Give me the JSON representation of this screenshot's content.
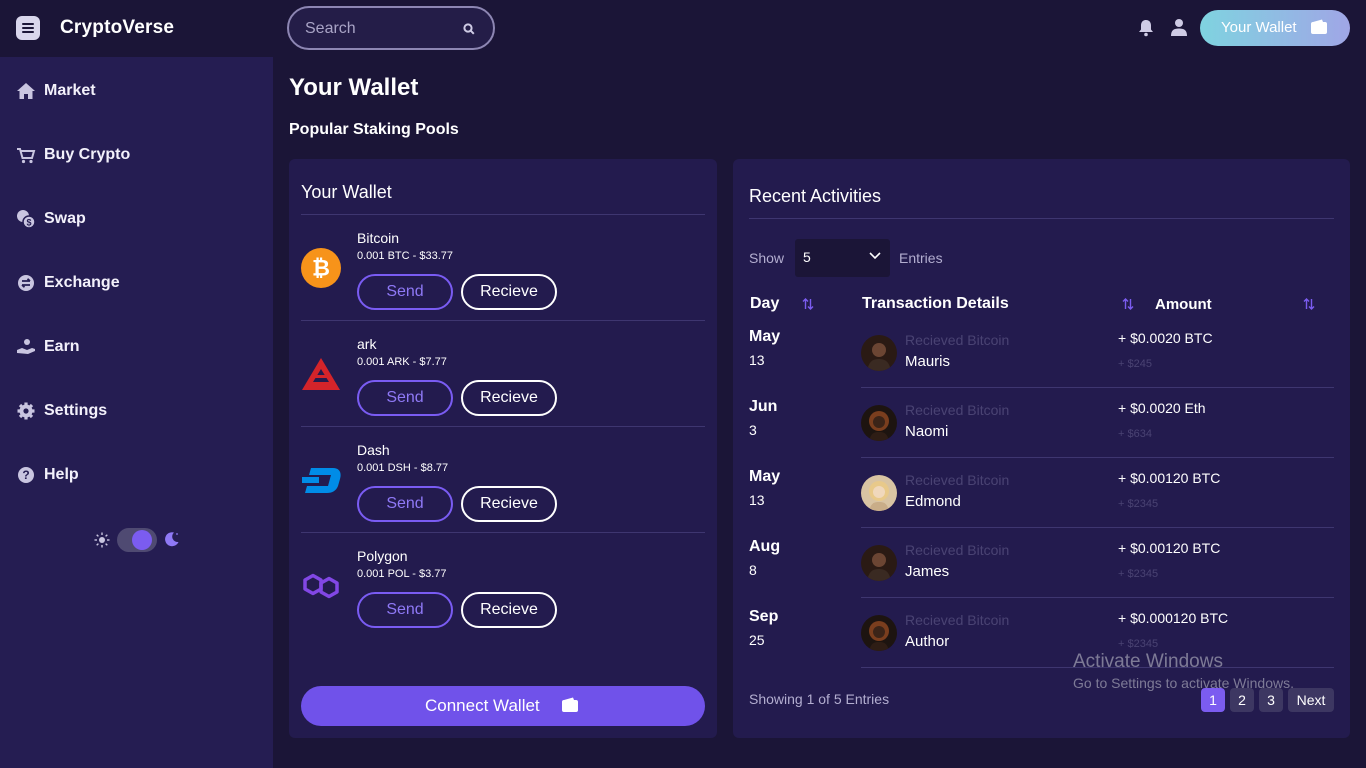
{
  "app": {
    "name": "CryptoVerse"
  },
  "header": {
    "search_placeholder": "Search",
    "wallet_button": "Your Wallet"
  },
  "sidebar": {
    "items": [
      {
        "label": "Market",
        "icon": "home-icon"
      },
      {
        "label": "Buy Crypto",
        "icon": "cart-icon"
      },
      {
        "label": "Swap",
        "icon": "coins-icon"
      },
      {
        "label": "Exchange",
        "icon": "exchange-icon"
      },
      {
        "label": "Earn",
        "icon": "hand-coin-icon"
      },
      {
        "label": "Settings",
        "icon": "gear-icon"
      },
      {
        "label": "Help",
        "icon": "help-icon"
      }
    ],
    "theme": "dark"
  },
  "page": {
    "title": "Your Wallet",
    "subtitle": "Popular Staking Pools"
  },
  "wallet": {
    "title": "Your Wallet",
    "send_label": "Send",
    "receive_label": "Recieve",
    "coins": [
      {
        "name": "Bitcoin",
        "value": "0.001 BTC - $33.77",
        "icon": "bitcoin-icon"
      },
      {
        "name": "ark",
        "value": "0.001 ARK - $7.77",
        "icon": "ark-icon"
      },
      {
        "name": "Dash",
        "value": "0.001 DSH - $8.77",
        "icon": "dash-icon"
      },
      {
        "name": "Polygon",
        "value": "0.001 POL - $3.77",
        "icon": "polygon-icon"
      }
    ],
    "connect_label": "Connect Wallet"
  },
  "activities": {
    "title": "Recent Activities",
    "show_label": "Show",
    "entries_value": "5",
    "entries_label": "Entries",
    "columns": [
      "Day",
      "Transaction Details",
      "Amount"
    ],
    "rows": [
      {
        "month": "May",
        "day": "13",
        "desc": "Recieved Bitcoin",
        "name": "Mauris",
        "amount": "+ $0.0020 BTC",
        "usd": "+ $245"
      },
      {
        "month": "Jun",
        "day": "3",
        "desc": "Recieved Bitcoin",
        "name": "Naomi",
        "amount": "+ $0.0020 Eth",
        "usd": "+ $634"
      },
      {
        "month": "May",
        "day": "13",
        "desc": "Recieved Bitcoin",
        "name": "Edmond",
        "amount": "+ $0.00120 BTC",
        "usd": "+ $2345"
      },
      {
        "month": "Aug",
        "day": "8",
        "desc": "Recieved Bitcoin",
        "name": "James",
        "amount": "+ $0.00120 BTC",
        "usd": "+ $2345"
      },
      {
        "month": "Sep",
        "day": "25",
        "desc": "Recieved Bitcoin",
        "name": "Author",
        "amount": "+ $0.000120 BTC",
        "usd": "+ $2345"
      }
    ],
    "footer": "Showing 1 of 5 Entries",
    "pages": [
      "1",
      "2",
      "3"
    ],
    "next_label": "Next"
  },
  "watermark": {
    "line1": "Activate Windows",
    "line2": "Go to Settings to activate Windows."
  },
  "colors": {
    "background": "#1b1537",
    "sidebar": "#251d52",
    "card": "#231b4e",
    "accent": "#7052ea"
  }
}
